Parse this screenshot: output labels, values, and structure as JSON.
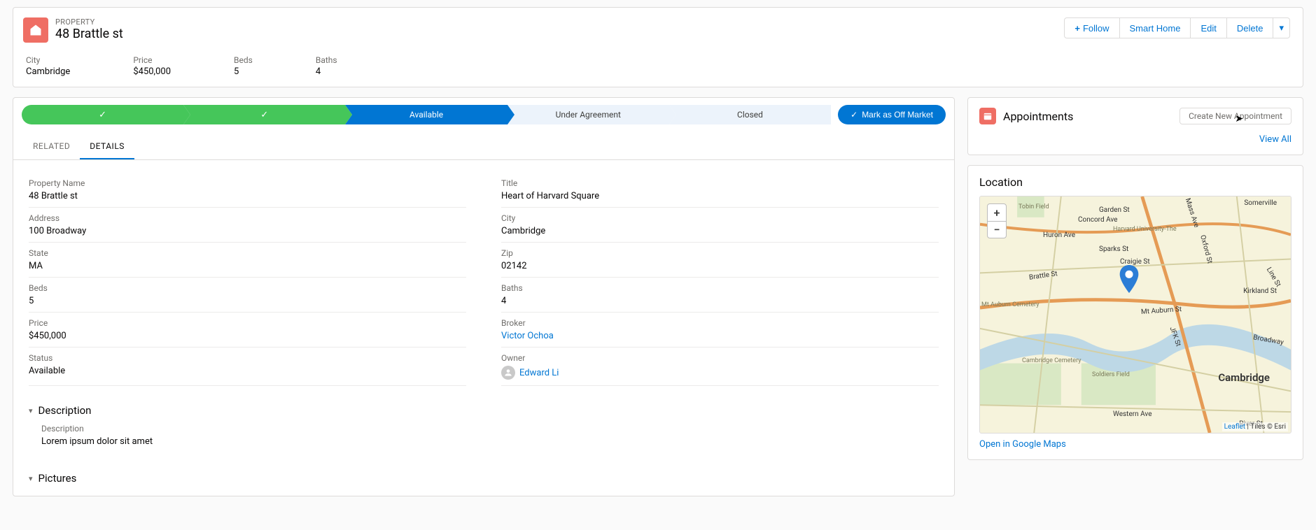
{
  "header": {
    "type_label": "PROPERTY",
    "title": "48 Brattle st",
    "actions": {
      "follow": "Follow",
      "smart_home": "Smart Home",
      "edit": "Edit",
      "delete": "Delete"
    },
    "summary": {
      "city_label": "City",
      "city_value": "Cambridge",
      "price_label": "Price",
      "price_value": "$450,000",
      "beds_label": "Beds",
      "beds_value": "5",
      "baths_label": "Baths",
      "baths_value": "4"
    }
  },
  "path": {
    "stage1": "",
    "stage2": "",
    "stage3": "Available",
    "stage4": "Under Agreement",
    "stage5": "Closed",
    "mark_button": "Mark as Off Market"
  },
  "tabs": {
    "related": "RELATED",
    "details": "DETAILS"
  },
  "details": {
    "property_name": {
      "label": "Property Name",
      "value": "48 Brattle st"
    },
    "title_field": {
      "label": "Title",
      "value": "Heart of Harvard Square"
    },
    "address": {
      "label": "Address",
      "value": "100 Broadway"
    },
    "city": {
      "label": "City",
      "value": "Cambridge"
    },
    "state": {
      "label": "State",
      "value": "MA"
    },
    "zip": {
      "label": "Zip",
      "value": "02142"
    },
    "beds": {
      "label": "Beds",
      "value": "5"
    },
    "baths": {
      "label": "Baths",
      "value": "4"
    },
    "price": {
      "label": "Price",
      "value": "$450,000"
    },
    "broker": {
      "label": "Broker",
      "value": "Victor Ochoa"
    },
    "status": {
      "label": "Status",
      "value": "Available"
    },
    "owner": {
      "label": "Owner",
      "value": "Edward Li"
    }
  },
  "sections": {
    "description_title": "Description",
    "description_label": "Description",
    "description_value": "Lorem ipsum dolor sit amet",
    "pictures_title": "Pictures"
  },
  "appointments": {
    "title": "Appointments",
    "create_button": "Create New Appointment",
    "view_all": "View All"
  },
  "location": {
    "title": "Location",
    "zoom_in": "+",
    "zoom_out": "−",
    "attribution_leaflet": "Leaflet",
    "attribution_rest": " | Tiles © Esri",
    "open_maps": "Open in Google Maps",
    "label_cambridge": "Cambridge",
    "street_mtauburn": "Mt Auburn St",
    "street_concord": "Concord Ave",
    "street_garden": "Garden St",
    "street_kirkland": "Kirkland St",
    "street_broadway": "Broadway",
    "street_river": "River St",
    "street_western": "Western Ave",
    "street_massave": "Mass Ave",
    "street_huron": "Huron Ave",
    "street_brattle": "Brattle St",
    "street_sparks": "Sparks St",
    "street_craigie": "Craigie St",
    "street_jfk": "JFK St",
    "street_oxford": "Oxford St",
    "street_line": "Line St",
    "place_cambcem": "Cambridge Cemetery",
    "place_mtaubcem": "Mt Auburn Cemetery",
    "place_soldiers": "Soldiers Field",
    "place_harvard": "Harvard University-The",
    "place_tobin": "Tobin Field",
    "place_somerville": "Somerville"
  }
}
